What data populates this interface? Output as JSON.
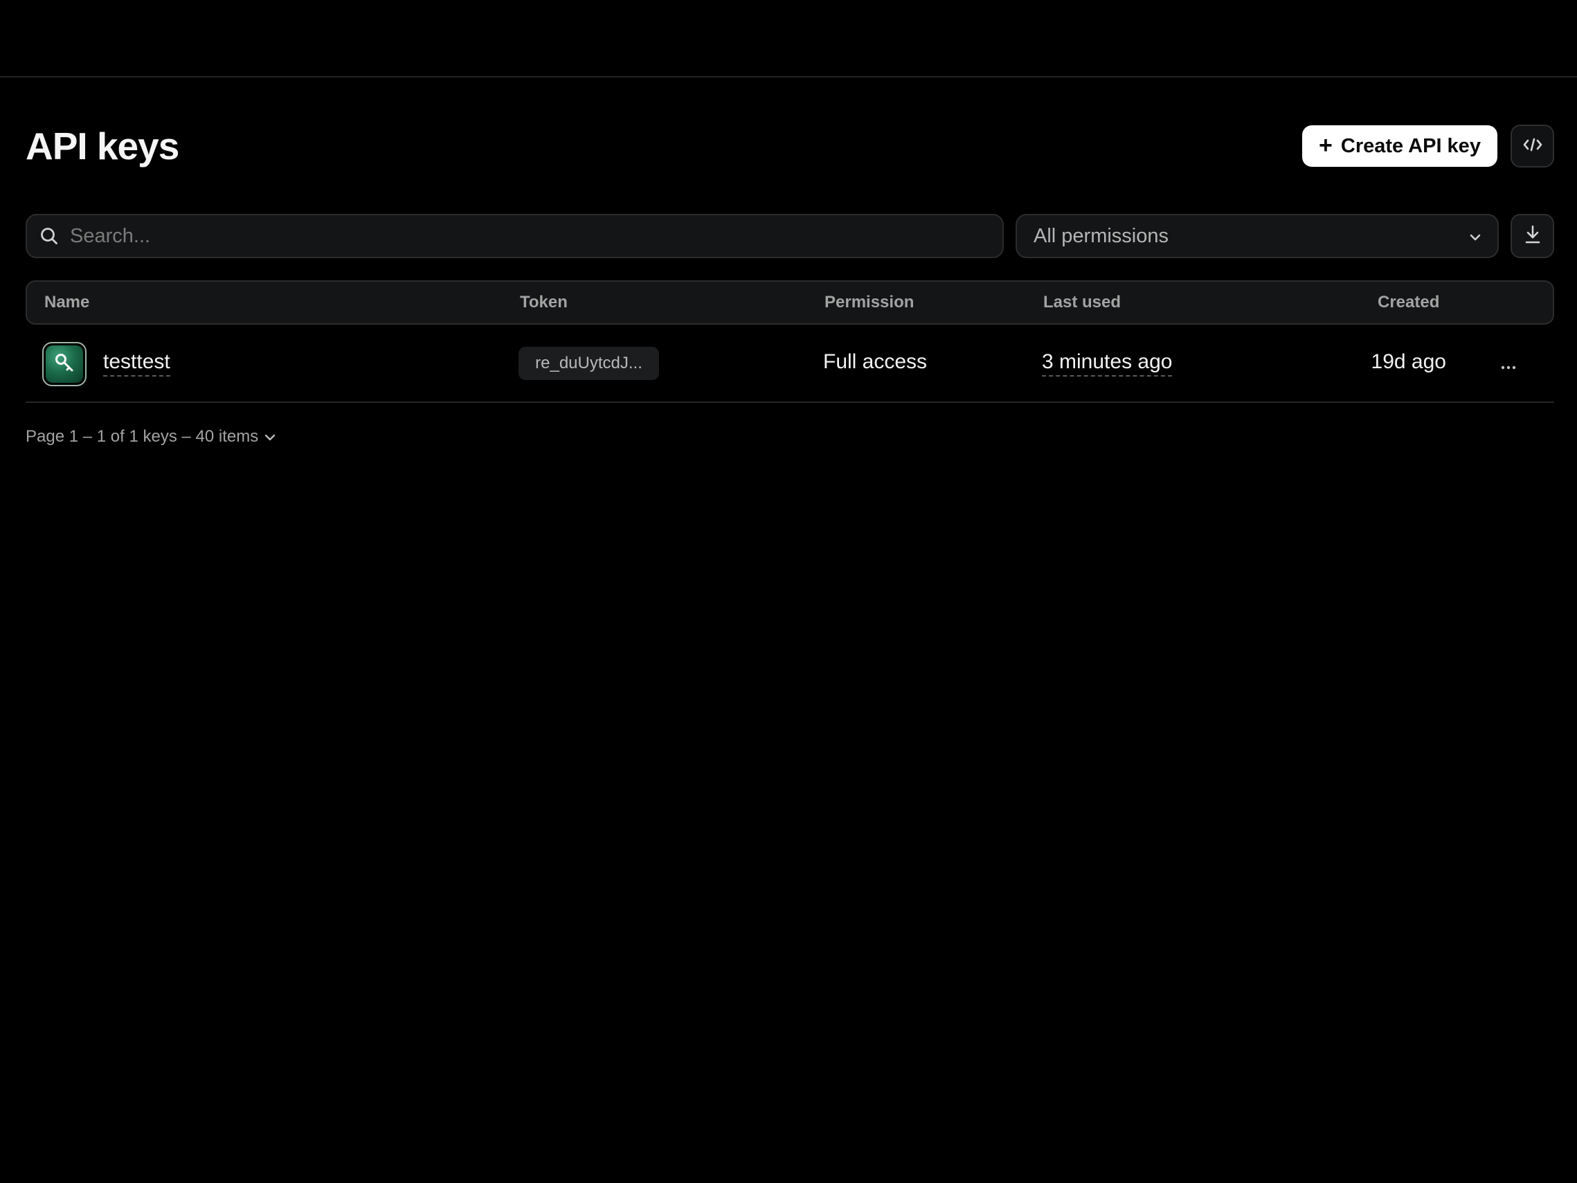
{
  "header": {
    "title": "API keys",
    "create_label": "Create API key",
    "create_icon": "plus-icon",
    "code_icon": "code-icon"
  },
  "filters": {
    "search_placeholder": "Search...",
    "search_value": "",
    "permission_selected": "All permissions",
    "download_icon": "download-icon"
  },
  "table": {
    "columns": [
      "Name",
      "Token",
      "Permission",
      "Last used",
      "Created"
    ],
    "rows": [
      {
        "name": "testtest",
        "icon": "key-icon",
        "token": "re_duUytcdJ...",
        "permission": "Full access",
        "last_used": "3 minutes ago",
        "created": "19d ago",
        "actions_icon": "more-horizontal-icon"
      }
    ]
  },
  "pagination": {
    "summary": "Page 1 – 1 of 1 keys – 40 items"
  },
  "colors": {
    "background": "#000000",
    "primary_button": "#ffffff",
    "surface": "#141516",
    "border": "#2c2c2c",
    "key_icon_accent": "#1b6b4a"
  }
}
